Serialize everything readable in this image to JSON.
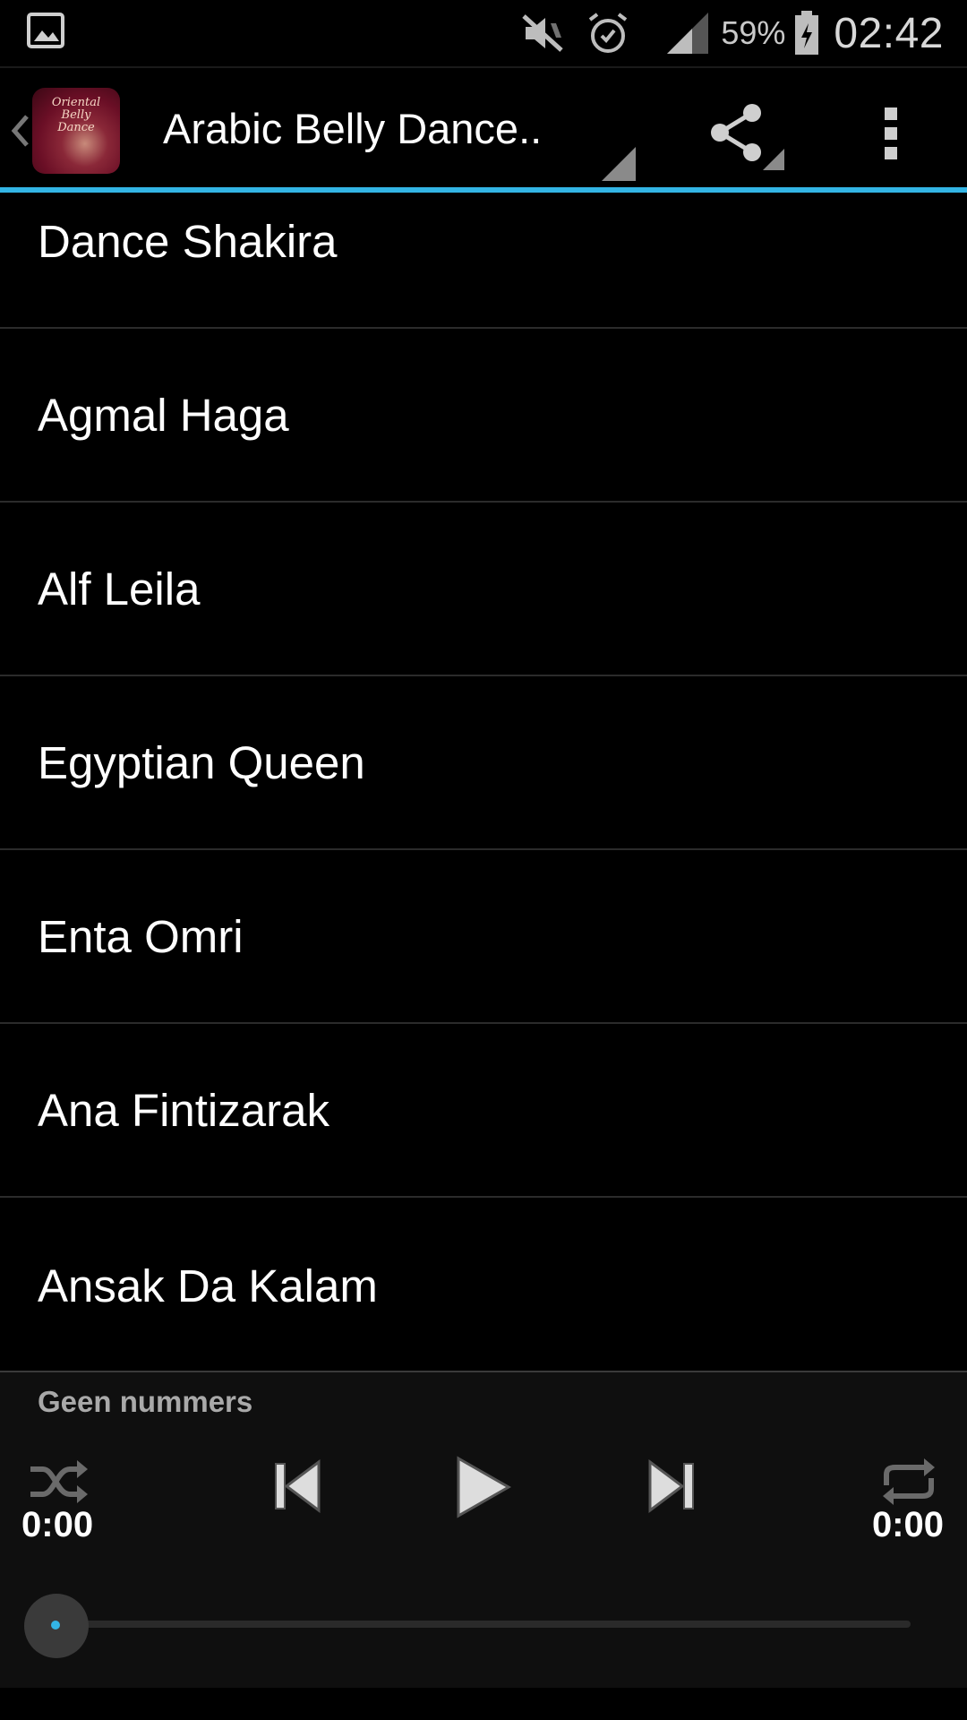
{
  "status_bar": {
    "notification_icon": "picture-notification-icon",
    "icons": [
      "muted-speaker-icon",
      "alarm-clock-icon",
      "signal-strength-icon"
    ],
    "battery_percent": "59%",
    "battery_icon": "battery-charging-icon",
    "time": "02:42"
  },
  "action_bar": {
    "back_icon": "chevron-left-icon",
    "app_logo_text": "Oriental Belly Dance",
    "title": "Arabic Belly Dance..",
    "share_icon": "share-icon",
    "overflow_icon": "overflow-menu-icon",
    "accent_color": "#33b5e5"
  },
  "tracks": [
    {
      "title": "Dance Shakira"
    },
    {
      "title": "Agmal Haga"
    },
    {
      "title": "Alf Leila"
    },
    {
      "title": "Egyptian Queen"
    },
    {
      "title": "Enta Omri"
    },
    {
      "title": "Ana Fintizarak"
    },
    {
      "title": "Ansak Da Kalam"
    }
  ],
  "player": {
    "now_playing": "Geen nummers",
    "elapsed": "0:00",
    "total": "0:00",
    "progress": 0,
    "controls": [
      "shuffle-icon",
      "previous-icon",
      "play-icon",
      "next-icon",
      "repeat-icon"
    ]
  }
}
